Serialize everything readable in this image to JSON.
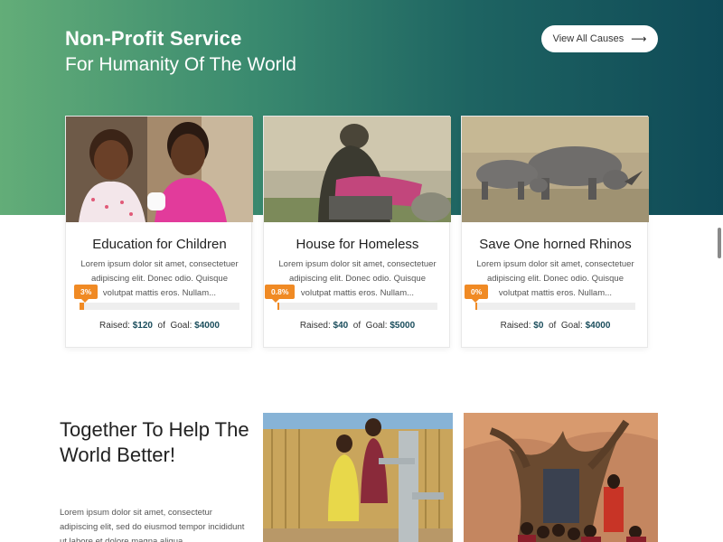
{
  "hero": {
    "title": "Non-Profit Service",
    "subtitle": "For Humanity Of The World",
    "view_all_label": "View All Causes",
    "view_all_icon": "arrow-right-icon"
  },
  "colors": {
    "gradient_start": "#63ad78",
    "gradient_end": "#0f4a57",
    "accent": "#f08a24",
    "amount": "#1a4d5c"
  },
  "causes": [
    {
      "title": "Education for Children",
      "desc": "Lorem ipsum dolor sit amet, consectetuer adipiscing elit. Donec odio. Quisque volutpat mattis eros. Nullam...",
      "percent_label": "3%",
      "progress": 0.03,
      "raised_label": "Raised:",
      "raised": "$120",
      "of_label": "of",
      "goal_label": "Goal:",
      "goal": "$4000"
    },
    {
      "title": "House for Homeless",
      "desc": "Lorem ipsum dolor sit amet, consectetuer adipiscing elit. Donec odio. Quisque volutpat mattis eros. Nullam...",
      "percent_label": "0.8%",
      "progress": 0.008,
      "raised_label": "Raised:",
      "raised": "$40",
      "of_label": "of",
      "goal_label": "Goal:",
      "goal": "$5000"
    },
    {
      "title": "Save One horned Rhinos",
      "desc": "Lorem ipsum dolor sit amet, consectetuer adipiscing elit. Donec odio. Quisque volutpat mattis eros. Nullam...",
      "percent_label": "0%",
      "progress": 0,
      "raised_label": "Raised:",
      "raised": "$0",
      "of_label": "of",
      "goal_label": "Goal:",
      "goal": "$4000"
    }
  ],
  "about": {
    "heading": "Together To Help The World Better!",
    "desc": "Lorem ipsum dolor sit amet, consectetur adipiscing elit, sed do eiusmod tempor incididunt ut labore et dolore magna aliqua."
  }
}
